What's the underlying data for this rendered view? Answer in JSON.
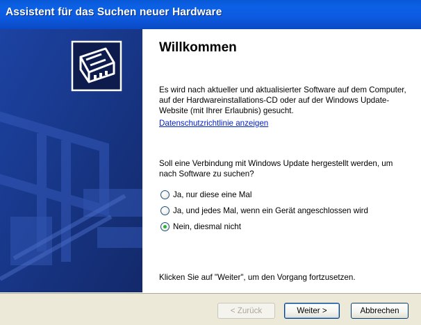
{
  "window": {
    "title": "Assistent für das Suchen neuer Hardware"
  },
  "main": {
    "heading": "Willkommen",
    "intro": "Es wird nach aktueller und aktualisierter Software auf dem Computer, auf der Hardwareinstallations-CD oder auf der Windows Update-Website (mit Ihrer Erlaubnis) gesucht.",
    "privacy_link": "Datenschutzrichtlinie anzeigen",
    "question": "Soll eine Verbindung mit Windows Update hergestellt werden, um nach Software zu suchen?",
    "options": [
      {
        "label": "Ja, nur diese eine Mal",
        "selected": false
      },
      {
        "label": "Ja, und jedes Mal, wenn ein Gerät angeschlossen wird",
        "selected": false
      },
      {
        "label": "Nein, diesmal nicht",
        "selected": true
      }
    ],
    "continue_hint": "Klicken Sie auf \"Weiter\", um den Vorgang fortzusetzen."
  },
  "buttons": {
    "back": "< Zurück",
    "next": "Weiter >",
    "cancel": "Abbrechen"
  },
  "colors": {
    "titlebar": "#0b61e6",
    "side_panel": "#1b3a8c",
    "link": "#0020cc",
    "radio_checked": "#2cb13c"
  },
  "icons": {
    "wizard_graphic": "hardware-card-icon"
  }
}
